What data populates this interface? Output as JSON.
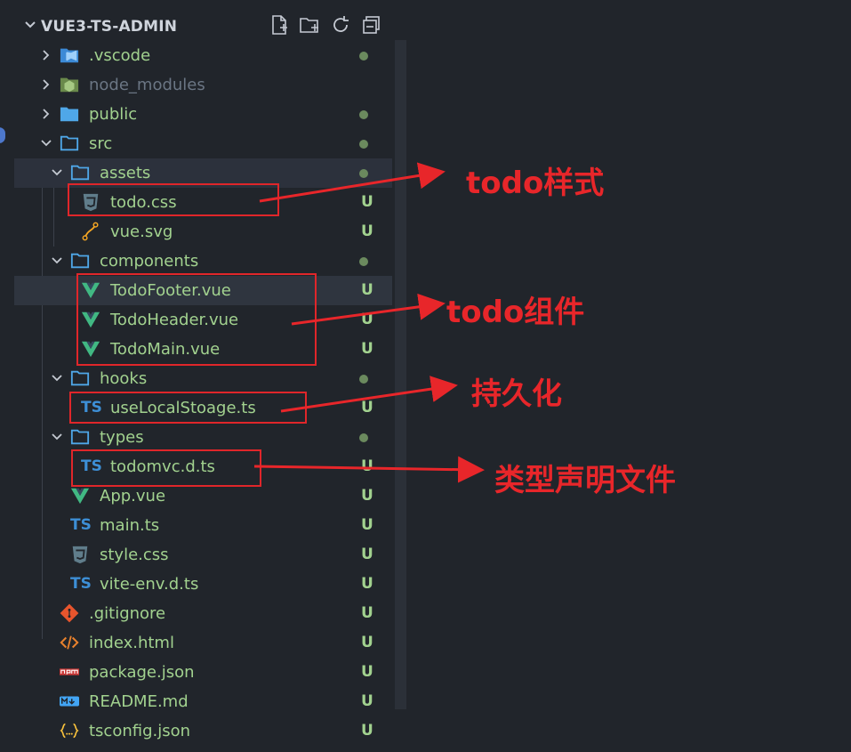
{
  "explorer": {
    "title": "VUE3-TS-ADMIN",
    "actions": [
      "new-file-icon",
      "new-folder-icon",
      "refresh-icon",
      "collapse-all-icon"
    ]
  },
  "tree": [
    {
      "label": ".vscode",
      "badge": "dot",
      "icon": "vscode-folder-icon",
      "expanded": false
    },
    {
      "label": "node_modules",
      "badge": "",
      "icon": "node-folder-icon",
      "expanded": false,
      "dimmed": true
    },
    {
      "label": "public",
      "badge": "dot",
      "icon": "folder-icon",
      "expanded": false
    },
    {
      "label": "src",
      "badge": "dot",
      "icon": "folder-open-icon",
      "expanded": true
    },
    {
      "label": "assets",
      "badge": "dot",
      "icon": "folder-open-icon",
      "expanded": true
    },
    {
      "label": "todo.css",
      "badge": "U",
      "icon": "css-file-icon"
    },
    {
      "label": "vue.svg",
      "badge": "U",
      "icon": "svg-file-icon"
    },
    {
      "label": "components",
      "badge": "dot",
      "icon": "folder-open-icon",
      "expanded": true
    },
    {
      "label": "TodoFooter.vue",
      "badge": "U",
      "icon": "vue-file-icon"
    },
    {
      "label": "TodoHeader.vue",
      "badge": "U",
      "icon": "vue-file-icon"
    },
    {
      "label": "TodoMain.vue",
      "badge": "U",
      "icon": "vue-file-icon"
    },
    {
      "label": "hooks",
      "badge": "dot",
      "icon": "folder-open-icon",
      "expanded": true
    },
    {
      "label": "useLocalStoage.ts",
      "badge": "U",
      "icon": "ts-file-icon"
    },
    {
      "label": "types",
      "badge": "dot",
      "icon": "folder-open-icon",
      "expanded": true
    },
    {
      "label": "todomvc.d.ts",
      "badge": "U",
      "icon": "ts-file-icon"
    },
    {
      "label": "App.vue",
      "badge": "U",
      "icon": "vue-file-icon"
    },
    {
      "label": "main.ts",
      "badge": "U",
      "icon": "ts-file-icon"
    },
    {
      "label": "style.css",
      "badge": "U",
      "icon": "css-file-icon"
    },
    {
      "label": "vite-env.d.ts",
      "badge": "U",
      "icon": "ts-file-icon"
    },
    {
      "label": ".gitignore",
      "badge": "U",
      "icon": "git-file-icon"
    },
    {
      "label": "index.html",
      "badge": "U",
      "icon": "html-file-icon"
    },
    {
      "label": "package.json",
      "badge": "U",
      "icon": "npm-file-icon"
    },
    {
      "label": "README.md",
      "badge": "U",
      "icon": "markdown-file-icon"
    },
    {
      "label": "tsconfig.json",
      "badge": "U",
      "icon": "json-file-icon"
    }
  ],
  "ts_glyph": "TS",
  "annotations": {
    "style": "todo样式",
    "components": "todo组件",
    "persist": "持久化",
    "types": "类型声明文件"
  },
  "colors": {
    "background": "#21252b",
    "untracked_green": "#a2d28f",
    "annotation_red": "#e8262a",
    "folder_blue": "#4fa7e8",
    "ts_blue": "#3d8fd6",
    "vue_green": "#41b883"
  }
}
